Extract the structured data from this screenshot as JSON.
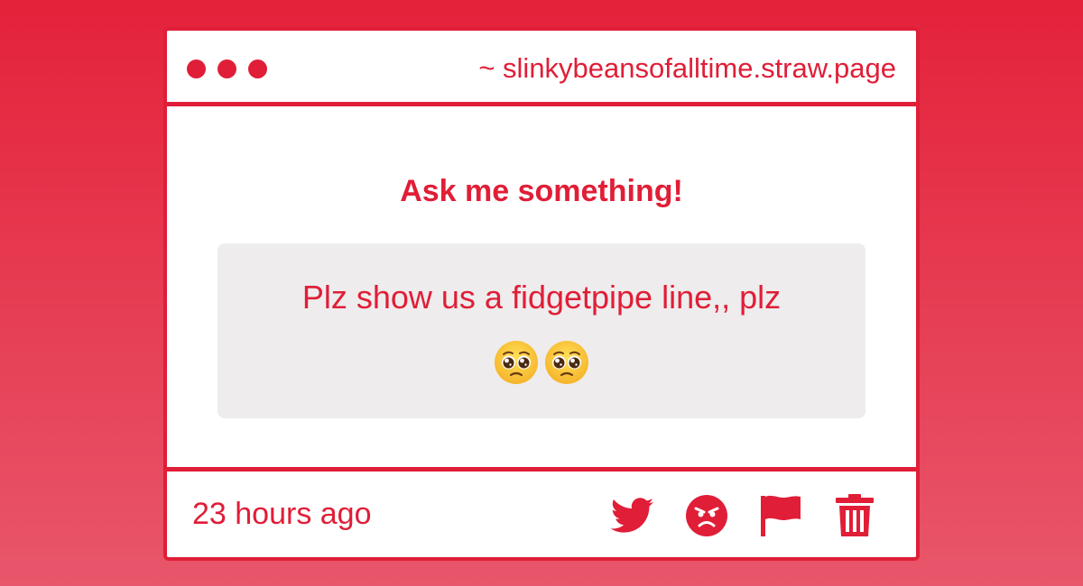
{
  "window": {
    "url": "~ slinkybeansofalltime.straw.page"
  },
  "content": {
    "title": "Ask me something!",
    "question": "Plz show us a fidgetpipe line,, plz",
    "emojis": [
      "pleading-face-emoji",
      "pleading-face-emoji"
    ]
  },
  "footer": {
    "timestamp": "23 hours ago",
    "actions": [
      "twitter-icon",
      "angry-face-icon",
      "flag-icon",
      "trash-icon"
    ]
  },
  "colors": {
    "accent": "#e01e37",
    "background_top": "#e4223a",
    "background_bottom": "#e8566b",
    "question_box": "#eeeced"
  }
}
